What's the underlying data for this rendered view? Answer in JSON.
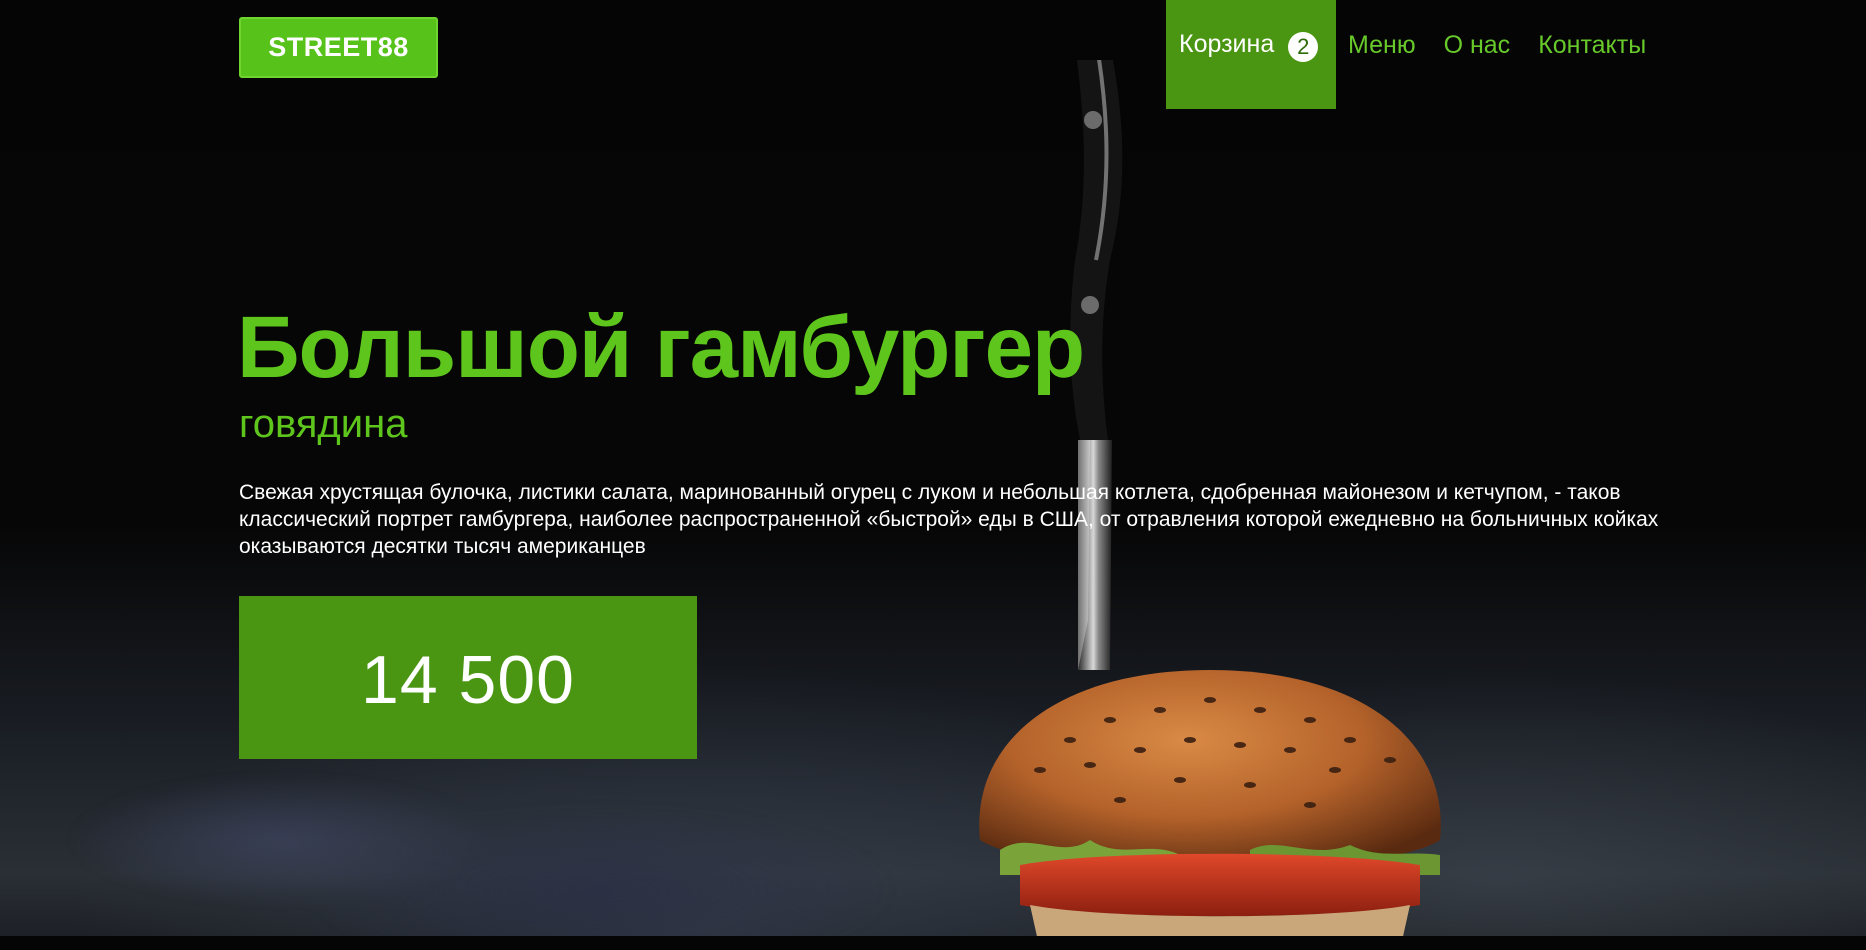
{
  "header": {
    "logo_text": "STREET88",
    "nav": {
      "cart_label": "Корзина",
      "cart_count": "2",
      "menu_label": "Меню",
      "about_label": "О нас",
      "contacts_label": "Контакты"
    }
  },
  "hero": {
    "title": "Большой гамбургер",
    "subtitle": "говядина",
    "description": "Свежая хрустящая булочка, листики салата, маринованный огурец с луком и небольшая котлета, сдобренная майонезом и кетчупом, - таков классический портрет гамбургера, наиболее распространенной «быстрой» еды в США, от отравления которой ежедневно на больничных койках оказываются десятки тысяч американцев",
    "price": "14 500"
  },
  "colors": {
    "accent": "#5ec51c",
    "accent_dark": "#4a9613",
    "background": "#030303"
  },
  "icons": {
    "hero_image": "burger-with-knife-photo"
  }
}
